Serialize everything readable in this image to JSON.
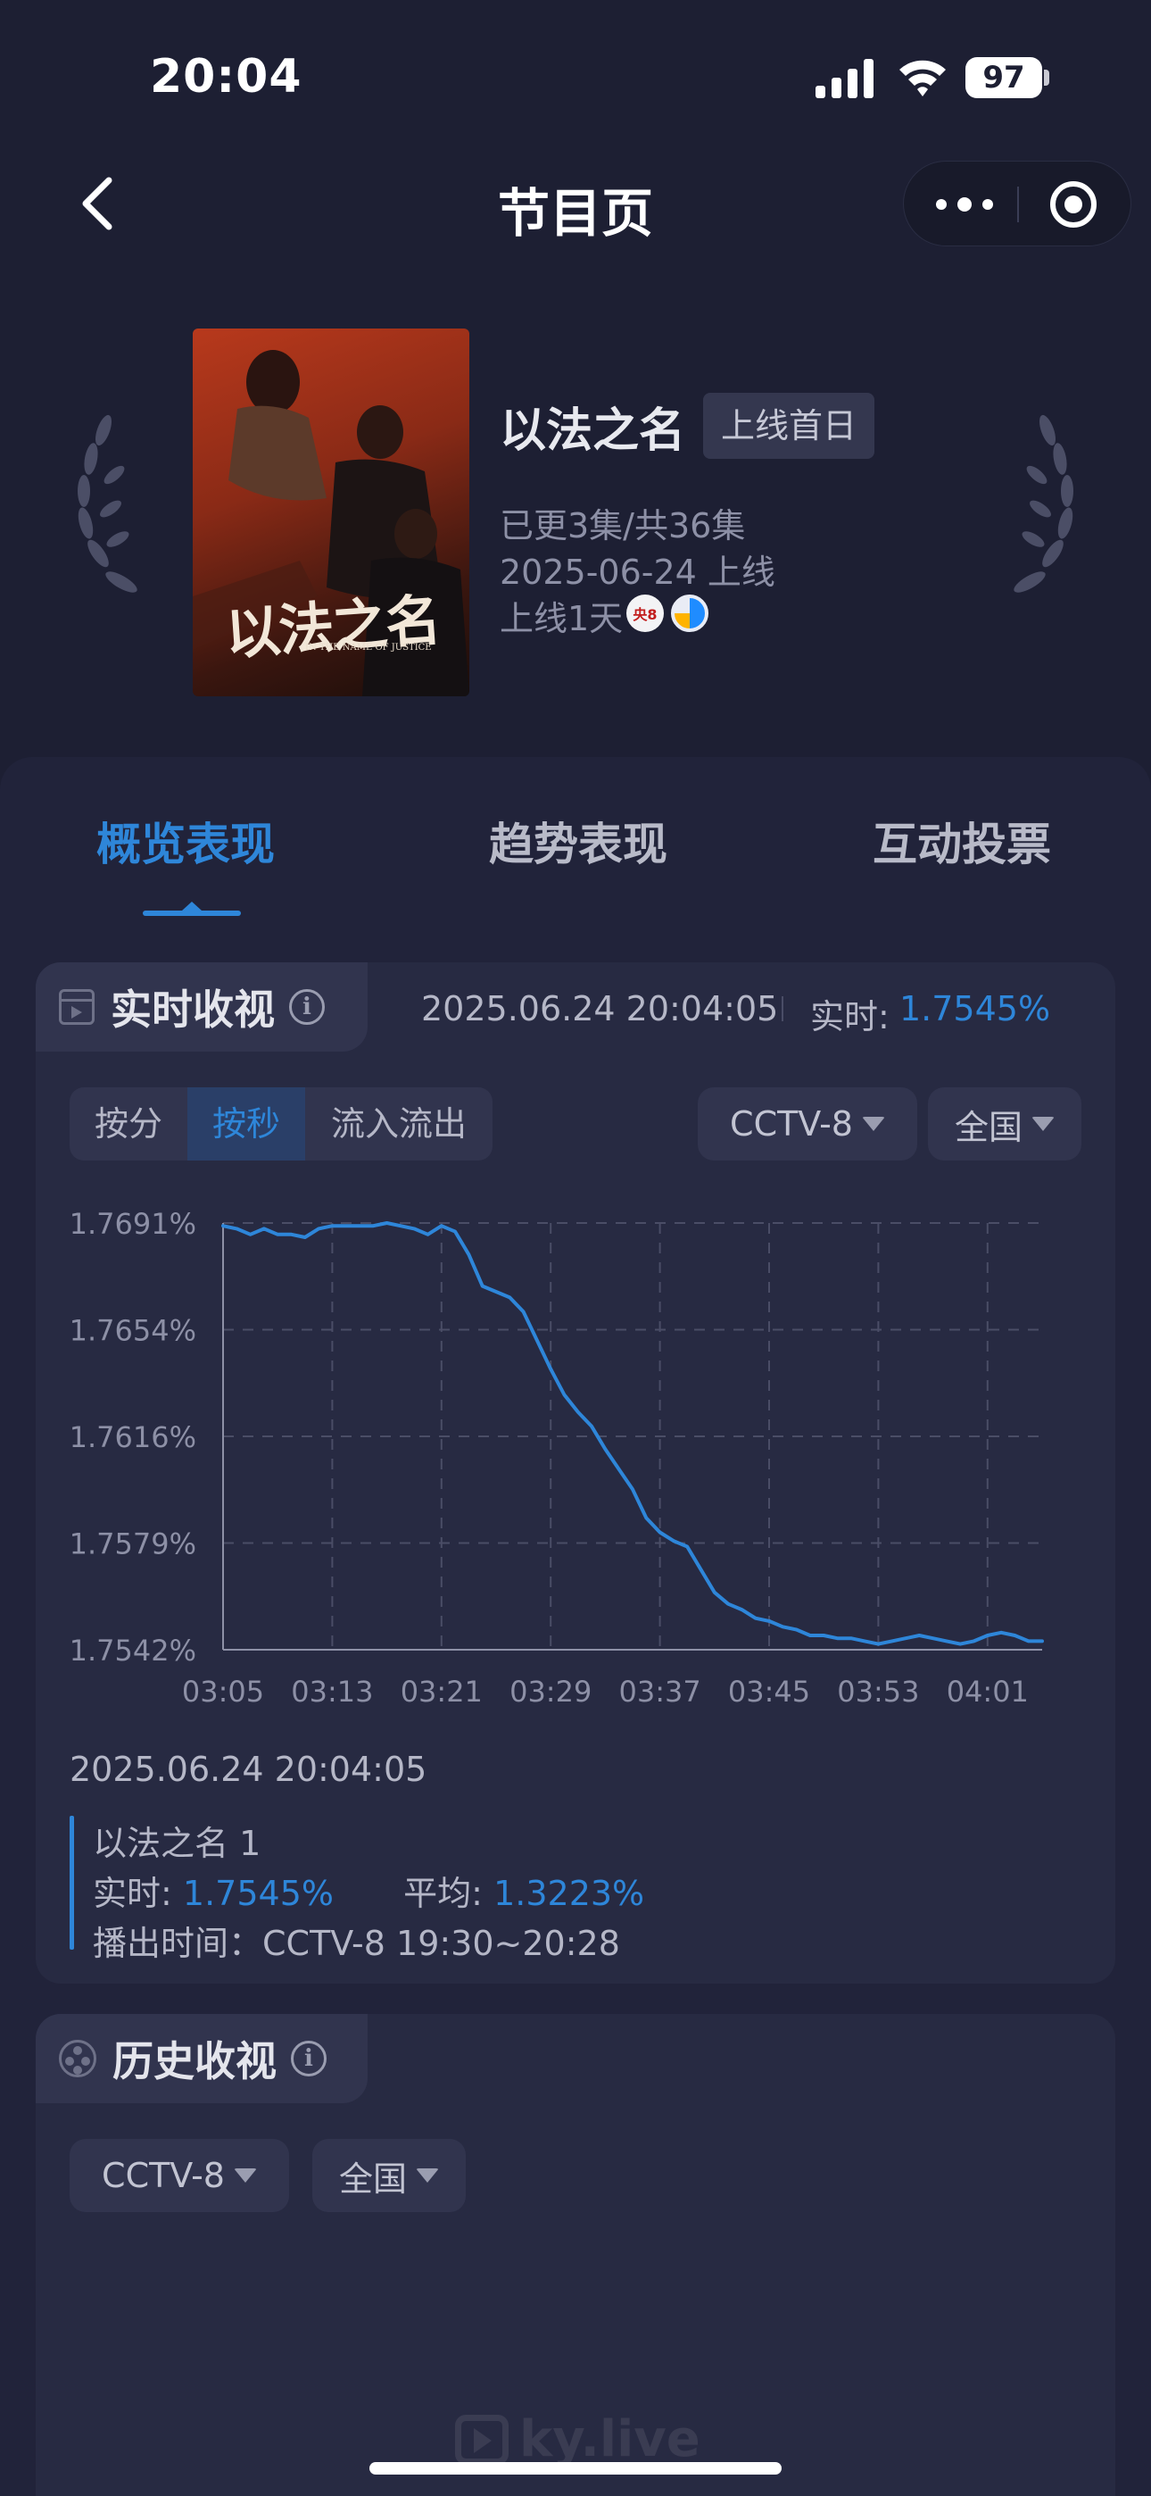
{
  "status_bar": {
    "time": "20:04",
    "battery": "97"
  },
  "nav": {
    "title": "节目页"
  },
  "show": {
    "name": "以法之名",
    "badge": "上线首日",
    "episodes": "已更3集/共36集",
    "premiere": "2025-06-24 上线",
    "days": "上线1天",
    "channel_badge": "央8",
    "poster_title": "以法之名",
    "poster_subtitle": "IN THE NAME OF JUSTICE"
  },
  "tabs": [
    "概览表现",
    "趋势表现",
    "互动投票"
  ],
  "realtime": {
    "heading": "实时收视",
    "timestamp": "2025.06.24 20:04:05",
    "label": "实时:",
    "value": "1.7545%",
    "segments": [
      "按分",
      "按秒",
      "流入流出"
    ],
    "channel": "CCTV-8",
    "region": "全国"
  },
  "chart_data": {
    "type": "line",
    "ylim": [
      1.7542,
      1.7691
    ],
    "yticks": [
      "1.7691%",
      "1.7654%",
      "1.7616%",
      "1.7579%",
      "1.7542%"
    ],
    "xticks": [
      "03:05",
      "03:13",
      "03:21",
      "03:29",
      "03:37",
      "03:45",
      "03:53",
      "04:01"
    ],
    "xlim": [
      185,
      245
    ],
    "x": [
      185,
      186,
      187,
      188,
      189,
      190,
      191,
      192,
      193,
      194,
      195,
      196,
      197,
      198,
      199,
      200,
      201,
      202,
      203,
      204,
      205,
      206,
      207,
      208,
      209,
      210,
      211,
      212,
      213,
      214,
      215,
      216,
      217,
      218,
      219,
      220,
      221,
      222,
      223,
      224,
      225,
      226,
      227,
      228,
      229,
      230,
      231,
      232,
      233,
      234,
      235,
      236,
      237,
      238,
      239,
      240,
      241,
      242,
      243,
      244,
      245
    ],
    "y": [
      1.769,
      1.7689,
      1.7687,
      1.7689,
      1.7687,
      1.7687,
      1.7686,
      1.7689,
      1.769,
      1.769,
      1.769,
      1.769,
      1.7691,
      1.769,
      1.7689,
      1.7687,
      1.769,
      1.7688,
      1.768,
      1.7669,
      1.7667,
      1.7665,
      1.766,
      1.765,
      1.764,
      1.7631,
      1.7625,
      1.762,
      1.7612,
      1.7605,
      1.7598,
      1.7588,
      1.7583,
      1.758,
      1.7578,
      1.757,
      1.7562,
      1.7558,
      1.7556,
      1.7553,
      1.7552,
      1.755,
      1.7549,
      1.7547,
      1.7547,
      1.7546,
      1.7546,
      1.7545,
      1.7544,
      1.7545,
      1.7546,
      1.7547,
      1.7546,
      1.7545,
      1.7544,
      1.7545,
      1.7547,
      1.7548,
      1.7547,
      1.7545,
      1.7545
    ],
    "color": "#2e86d9",
    "grid": true
  },
  "detail": {
    "timestamp": "2025.06.24 20:04:05",
    "episode": "以法之名 1",
    "realtime_label": "实时:",
    "realtime_value": "1.7545%",
    "avg_label": "平均:",
    "avg_value": "1.3223%",
    "airtime": "播出时间：CCTV-8 19:30~20:28"
  },
  "history": {
    "heading": "历史收视",
    "channel": "CCTV-8",
    "region": "全国"
  },
  "watermark": "ky.live",
  "colors": {
    "accent": "#2e86d9",
    "background": "#1d1f33",
    "card": "#272a42"
  }
}
